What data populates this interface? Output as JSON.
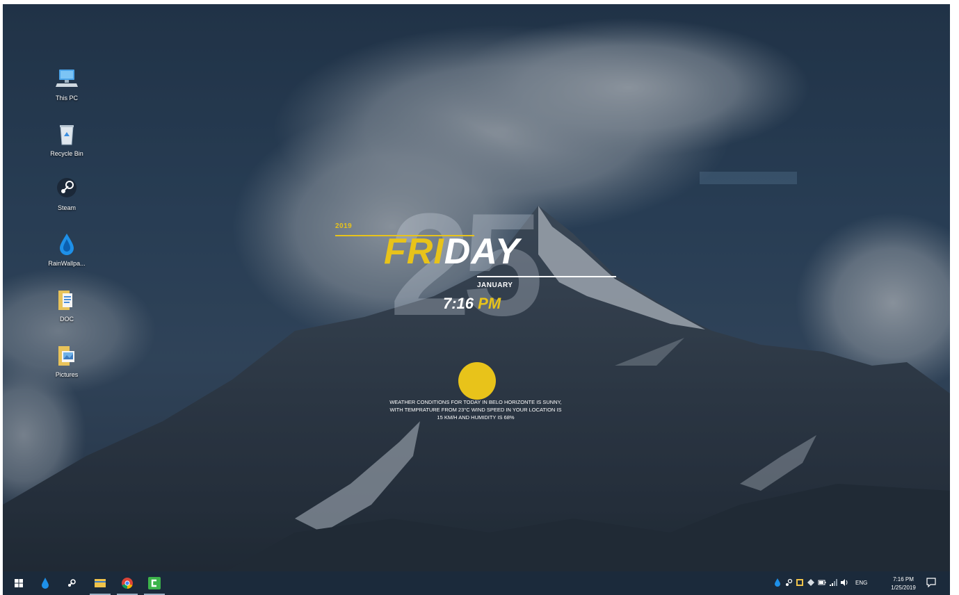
{
  "desktop": {
    "icons": [
      {
        "label": "This PC",
        "icon": "computer-icon"
      },
      {
        "label": "Recycle Bin",
        "icon": "recycle-bin-icon"
      },
      {
        "label": "Steam",
        "icon": "steam-icon"
      },
      {
        "label": "RainWallpa...",
        "icon": "rainwallpaper-icon"
      },
      {
        "label": "DOC",
        "icon": "folder-icon"
      },
      {
        "label": "Pictures",
        "icon": "pictures-folder-icon"
      }
    ]
  },
  "widget": {
    "year": "2019",
    "date_number": "25",
    "day_highlight": "FRI",
    "day_rest": "DAY",
    "month": "JANUARY",
    "time": "7:16",
    "ampm": "PM",
    "weather_text": "WEATHER CONDITIONS FOR TODAY IN BELO HORIZONTE IS SUNNY, WITH TEMPRATURE FROM 23°C WIND SPEED IN YOUR LOCATION IS 15 KM/H AND HUMIDITY IS 68%",
    "accent_color": "#e8c31a"
  },
  "taskbar": {
    "pinned": [
      {
        "icon": "windows-start-icon",
        "active": false
      },
      {
        "icon": "rainwallpaper-icon",
        "active": false
      },
      {
        "icon": "steam-icon",
        "active": false
      },
      {
        "icon": "file-explorer-icon",
        "active": true
      },
      {
        "icon": "chrome-icon",
        "active": true
      },
      {
        "icon": "camtasia-icon",
        "active": true
      }
    ],
    "tray": {
      "language": "ENG",
      "time": "7:16 PM",
      "date": "1/25/2019"
    }
  }
}
